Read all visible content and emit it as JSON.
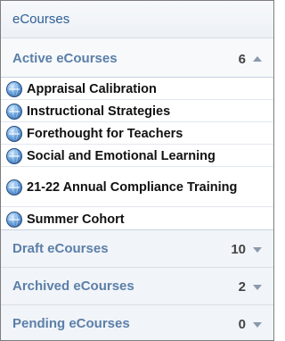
{
  "panel": {
    "title": "eCourses"
  },
  "sections": {
    "active": {
      "label": "Active eCourses",
      "count": "6",
      "expanded": true,
      "courses": [
        {
          "label": "Appraisal Calibration"
        },
        {
          "label": "Instructional Strategies"
        },
        {
          "label": "Forethought for Teachers"
        },
        {
          "label": "Social and Emotional Learning"
        },
        {
          "label": "21-22 Annual Compliance Training"
        },
        {
          "label": "Summer Cohort"
        }
      ]
    },
    "draft": {
      "label": "Draft eCourses",
      "count": "10",
      "expanded": false
    },
    "archived": {
      "label": "Archived eCourses",
      "count": "2",
      "expanded": false
    },
    "pending": {
      "label": "Pending eCourses",
      "count": "0",
      "expanded": false
    }
  },
  "icons": {
    "course": "globe-icon",
    "collapse": "triangle-up-icon",
    "expand": "triangle-down-icon"
  },
  "colors": {
    "header_text": "#2e5e95",
    "section_text": "#5b7fa8",
    "border": "#7d7d7d"
  }
}
